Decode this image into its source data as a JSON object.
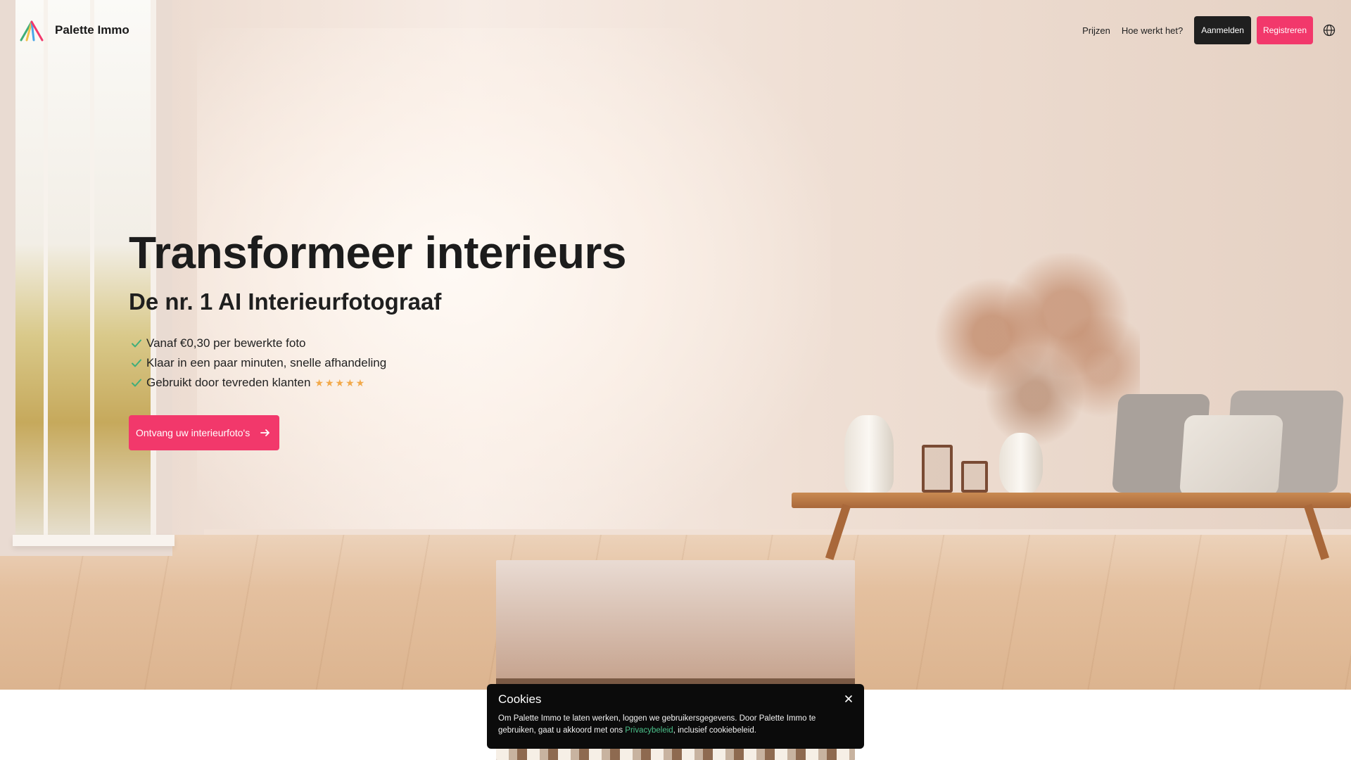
{
  "brand": {
    "name": "Palette Immo"
  },
  "nav": {
    "links": [
      "Prijzen",
      "Hoe werkt het?"
    ],
    "login_label": "Aanmelden",
    "register_label": "Registreren",
    "language_icon": "globe-icon"
  },
  "hero": {
    "title": "Transformeer interieurs",
    "subtitle": "De nr. 1 AI Interieurfotograaf",
    "features": [
      "Vanaf €0,30 per bewerkte foto",
      "Klaar in een paar minuten, snelle afhandeling",
      "Gebruikt door tevreden klanten"
    ],
    "rating_stars": 5,
    "cta_label": "Ontvang uw interieurfoto's"
  },
  "cookies": {
    "title": "Cookies",
    "text_before_link": "Om Palette Immo te laten werken, loggen we gebruikersgegevens. Door Palette Immo te gebruiken, gaat u akkoord met ons ",
    "link_label": "Privacybeleid",
    "text_after_link": ", inclusief cookiebeleid."
  },
  "colors": {
    "accent": "#f2386b",
    "dark": "#1f1f1f",
    "check": "#3fae7a",
    "star": "#f2a94a",
    "link": "#4bc08a"
  }
}
